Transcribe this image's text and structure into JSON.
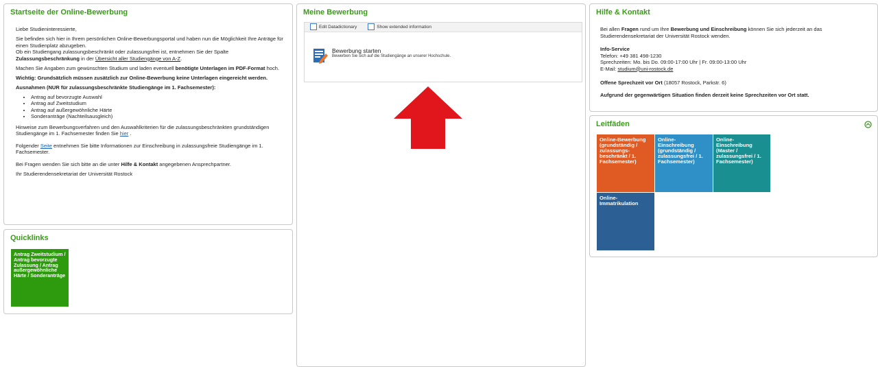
{
  "colors": {
    "accent": "#3a9a1a",
    "arrow": "#e0161c",
    "tile_orange": "#e05a24",
    "tile_blue": "#2f90c8",
    "tile_teal": "#1a8f92",
    "tile_navy": "#2c5f94",
    "tile_green": "#2e9a0e"
  },
  "start": {
    "title": "Startseite der Online-Bewerbung",
    "greeting": "Liebe Studieninteressierte,",
    "intro": "Sie befinden sich hier in Ihrem persönlichen Online-Bewerbungsportal und haben nun die Möglichkeit Ihre Anträge für einen Studienplatz abzugeben.",
    "line2_pre": "Ob ein Studiengang zulassungsbeschränkt oder zulassungsfrei ist, entnehmen Sie der Spalte ",
    "line2_bold": "Zulassungsbeschränkung",
    "line2_mid": " in der ",
    "line2_link": "Übersicht aller Studiengänge von A-Z",
    "line2_end": ".",
    "p3_pre": "Machen Sie Angaben zum gewünschten Studium und laden eventuell ",
    "p3_bold": "benötigte Unterlagen im PDF-Format",
    "p3_end": " hoch.",
    "p4": "Wichtig: Grundsätzlich müssen zusätzlich zur Online-Bewerbung keine Unterlagen eingereicht werden.",
    "p5": "Ausnahmen (NUR für zulassungsbeschränkte Studiengänge im 1. Fachsemester):",
    "bullets": [
      "Antrag auf bevorzugte Auswahl",
      "Antrag auf Zweitstudium",
      "Antrag auf außergewöhnliche Härte",
      "Sonderanträge (Nachteilsausgleich)"
    ],
    "p6_pre": "Hinweise zum Bewerbungsverfahren und den Auswahlkriterien für die zulassungsbeschränkten grundständigen Studiengänge im 1. Fachsemester finden Sie ",
    "p6_link": "hier",
    "p6_end": " .",
    "p7_pre": "Folgender ",
    "p7_link": "Seite",
    "p7_end": " entnehmen Sie bitte Informationen zur Einschreibung in zulassungsfreie Studiengänge im 1. Fachsemester.",
    "p8_pre": "Bei Fragen wenden Sie sich bitte an die unter ",
    "p8_bold": "Hilfe & Kontakt",
    "p8_end": " angegebenen Ansprechpartner.",
    "p9": "Ihr Studierendensekretariat der Universität Rostock"
  },
  "quicklinks": {
    "title": "Quicklinks",
    "tile": "Antrag Zweitstudium / Antrag bevorzugte Zulassung / Antrag außergewöhnliche Härte / Sonderanträge"
  },
  "bewerbung": {
    "title": "Meine Bewerbung",
    "edit_dd": "Edit Datadictionary",
    "show_ext": "Show extended information",
    "start_title": "Bewerbung starten",
    "start_sub": "Bewerben Sie sich auf die Studiengänge an unserer Hochschule."
  },
  "hilfe": {
    "title": "Hilfe & Kontakt",
    "p1_a": "Bei allen ",
    "p1_b": "Fragen",
    "p1_c": " rund um Ihre ",
    "p1_d": "Bewerbung und Einschreibung",
    "p1_e": " können Sie sich jederzeit an das Studierendensekretariat der Universität Rostock wenden.",
    "info_title": "Info-Service",
    "phone": "Telefon: +49 381 498-1230",
    "hours": "Sprechzeiten: Mo. bis Do. 09:00-17:00 Uhr | Fr. 09:00-13:00 Uhr",
    "email_label": "E-Mail: ",
    "email": "studium@uni-rostock.de",
    "office_bold": "Offene Sprechzeit vor Ort",
    "office_rest": " (18057 Rostock, Parkstr. 6)",
    "notice": "Aufgrund der gegenwärtigen Situation finden derzeit keine Sprechzeiten vor Ort statt."
  },
  "leitfaden": {
    "title": "Leitfäden",
    "tiles": [
      "Online-Bewerbung (grundständig / zulassungs-beschränkt / 1. Fachsemester)",
      "Online-Einschreibung (grundständig / zulassungsfrei / 1. Fachsemester)",
      "Online-Einschreibung (Master / zulassungsfrei / 1. Fachsemester)",
      "Online-Immatrikulation"
    ]
  }
}
